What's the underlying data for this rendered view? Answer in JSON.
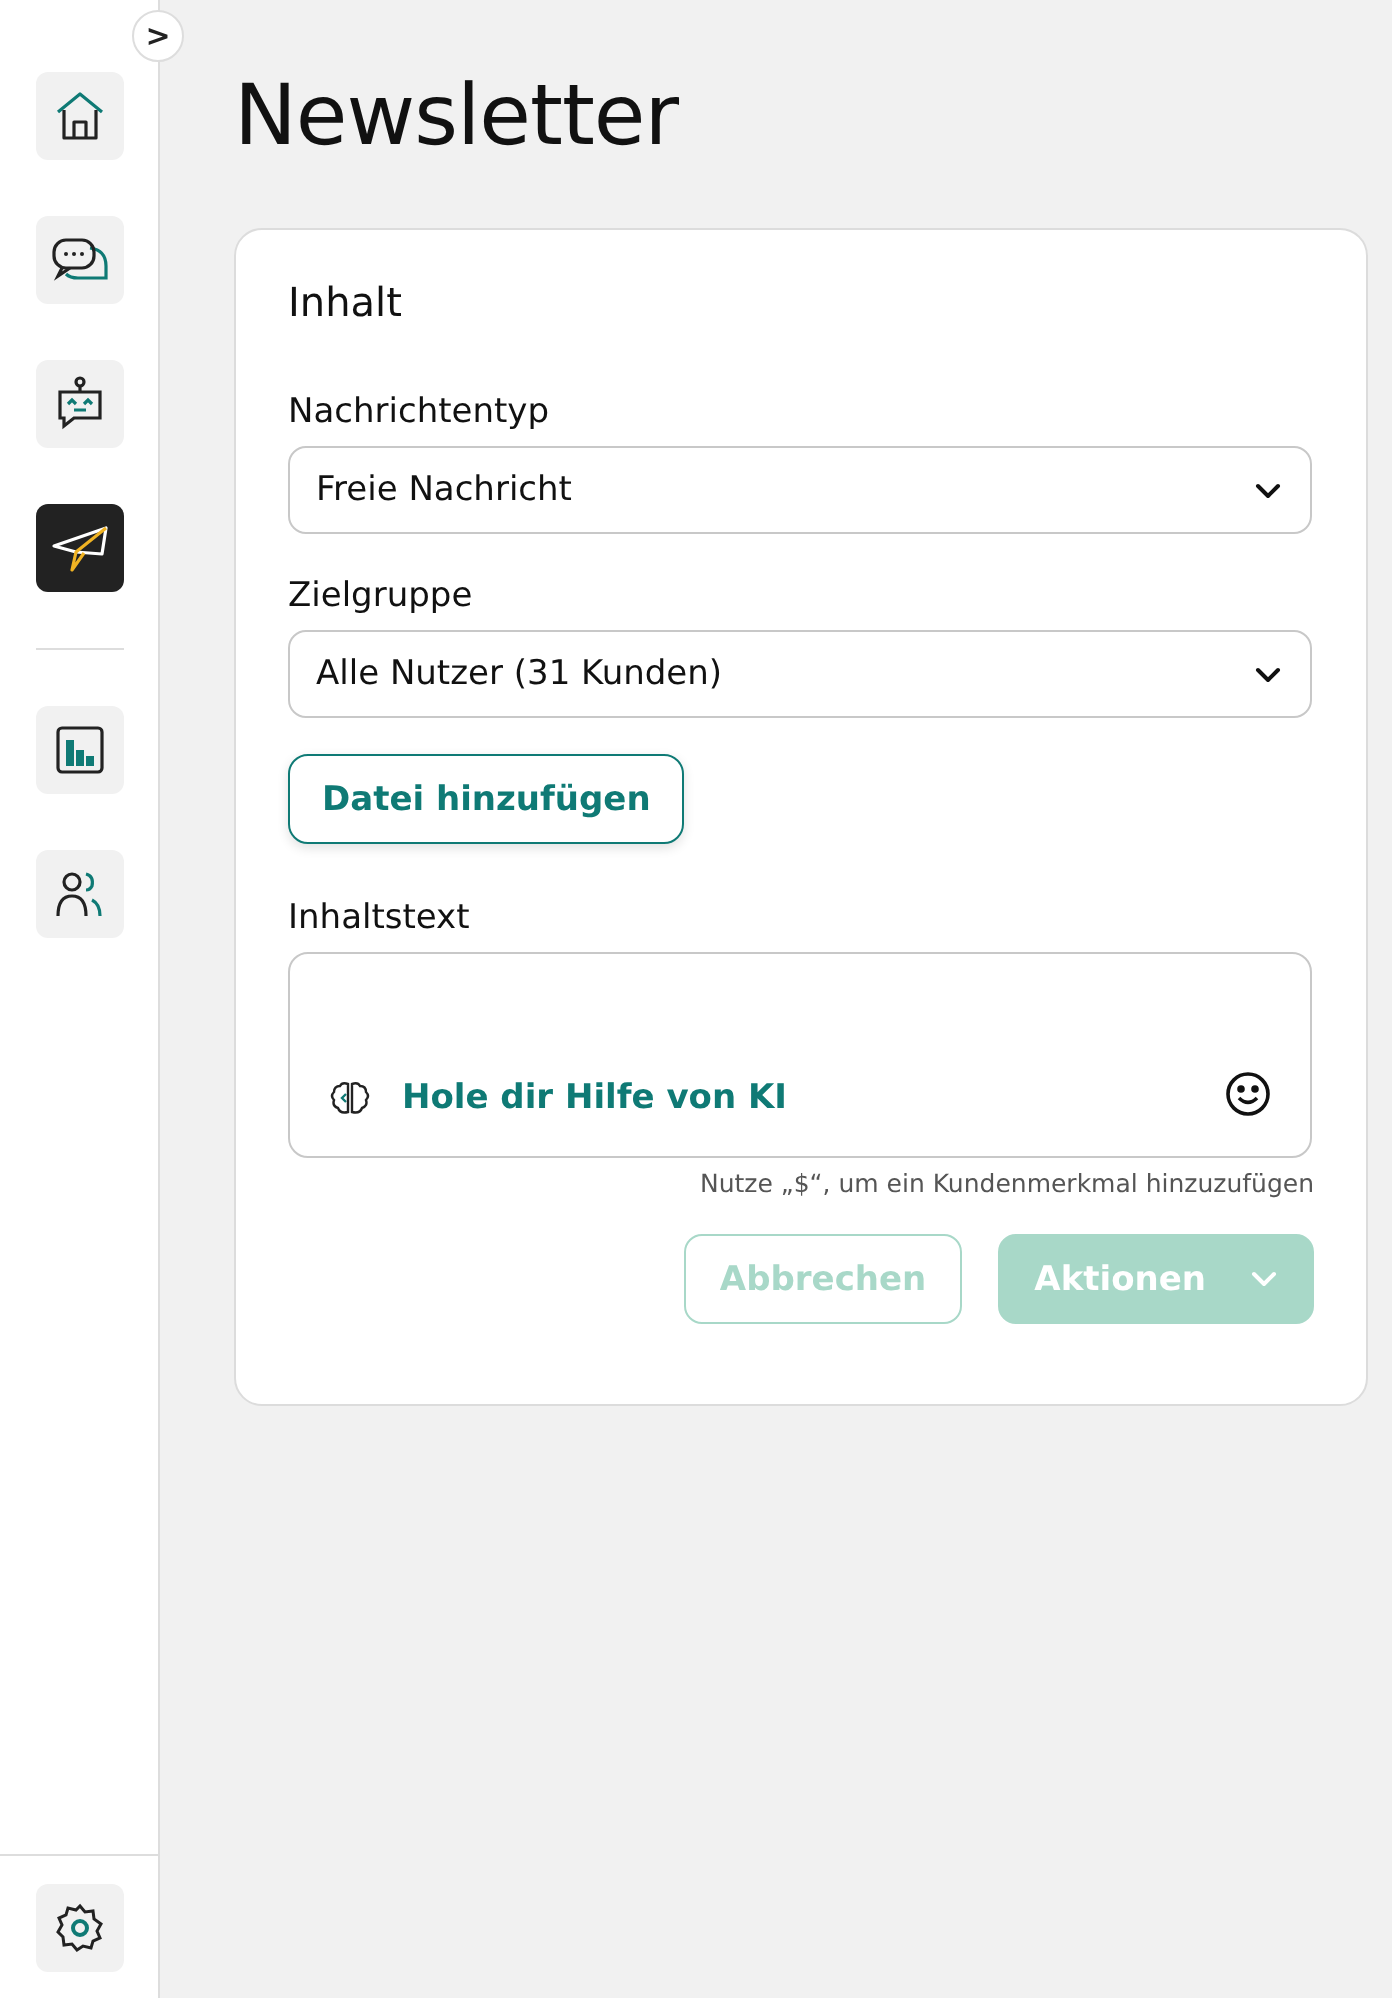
{
  "sidebar": {
    "toggle": ">",
    "items": [
      {
        "kind": "home",
        "selected": false
      },
      {
        "kind": "chat",
        "selected": false
      },
      {
        "kind": "bot",
        "selected": false
      },
      {
        "kind": "send",
        "selected": true
      },
      {
        "kind": "divider"
      },
      {
        "kind": "stats",
        "selected": false
      },
      {
        "kind": "users",
        "selected": false
      }
    ],
    "footer": [
      {
        "kind": "settings",
        "selected": false
      }
    ]
  },
  "page": {
    "title": "Newsletter"
  },
  "card": {
    "heading": "Inhalt",
    "fields": [
      {
        "label": "Nachrichtentyp",
        "value": "Freie Nachricht"
      },
      {
        "label": "Zielgruppe",
        "value": "Alle Nutzer (31 Kunden)"
      }
    ],
    "attach_button": "Datei hinzufügen",
    "text_field": {
      "label": "Inhaltstext",
      "ai_link": "Hole dir Hilfe von KI",
      "hint": "Nutze „$“, um ein Kundenmerkmal hinzuzufügen"
    },
    "buttons": [
      {
        "label": "Abbrechen",
        "kind": "secondary",
        "disabled": true
      },
      {
        "label": "Aktionen",
        "kind": "menu",
        "disabled": true
      }
    ]
  }
}
